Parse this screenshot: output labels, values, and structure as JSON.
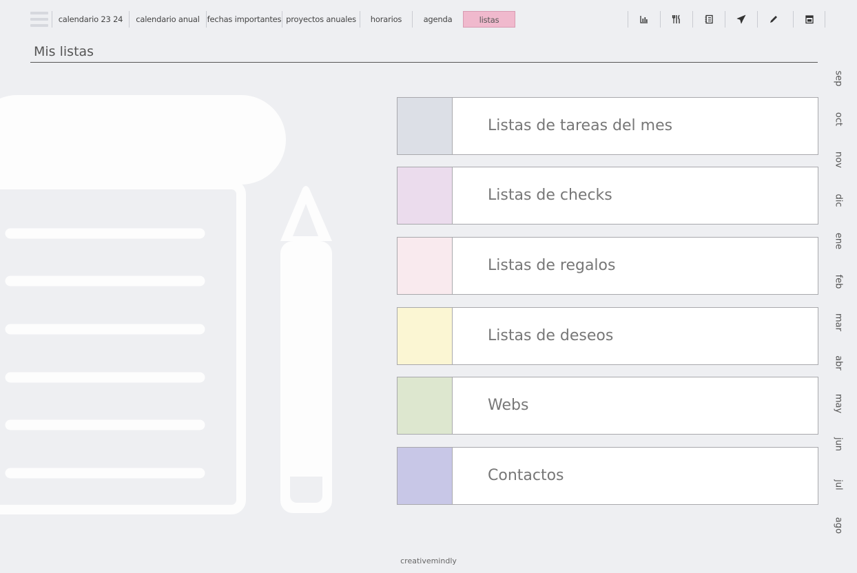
{
  "nav": {
    "tabs": [
      {
        "label": "calendario 23 24"
      },
      {
        "label": "calendario anual"
      },
      {
        "label": "fechas importantes"
      },
      {
        "label": "proyectos anuales"
      },
      {
        "label": "horarios"
      },
      {
        "label": "agenda"
      },
      {
        "label": "listas",
        "active": true
      }
    ],
    "tools": [
      {
        "icon": "bar-chart-icon"
      },
      {
        "icon": "cutlery-icon"
      },
      {
        "icon": "notebook-icon"
      },
      {
        "icon": "airplane-icon"
      },
      {
        "icon": "pencil-icon"
      },
      {
        "icon": "calendar-icon"
      }
    ],
    "active_color": "#f0b9cd"
  },
  "page": {
    "title": "Mis listas"
  },
  "lists": [
    {
      "label": "Listas de tareas del mes",
      "color": "#dcdfe6"
    },
    {
      "label": "Listas de checks",
      "color": "#ebdced"
    },
    {
      "label": "Listas de regalos",
      "color": "#f9eaee"
    },
    {
      "label": "Listas de deseos",
      "color": "#fbf6d3"
    },
    {
      "label": "Webs",
      "color": "#dde7cf"
    },
    {
      "label": "Contactos",
      "color": "#c8c7e7"
    }
  ],
  "months": [
    "sep",
    "oct",
    "nov",
    "dic",
    "ene",
    "feb",
    "mar",
    "abr",
    "may",
    "jun",
    "jul",
    "ago"
  ],
  "footer": {
    "brand": "creativemindly"
  }
}
